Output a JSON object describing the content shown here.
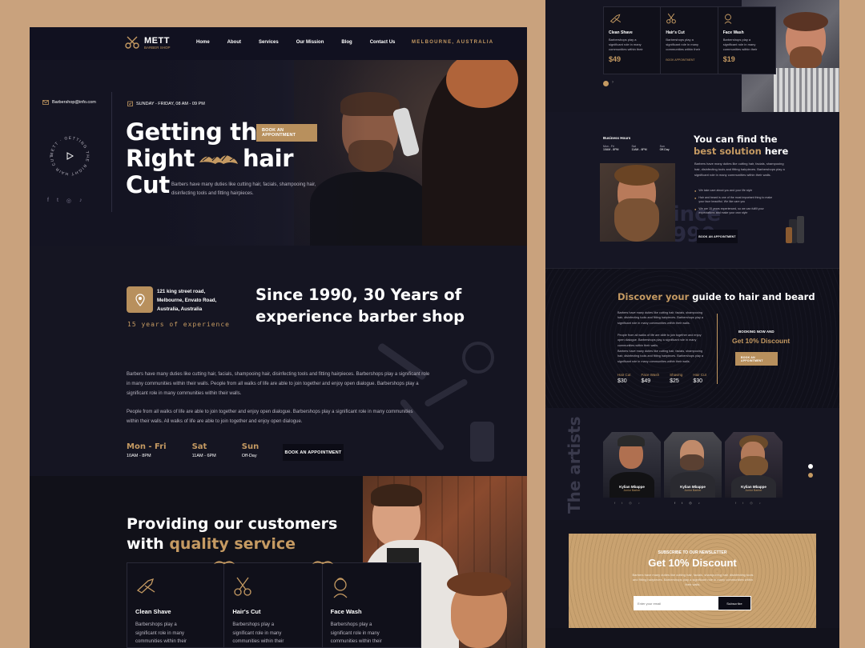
{
  "colors": {
    "background": "#c9a27d",
    "page": "#14141f",
    "gold": "#c59a62",
    "dark": "#0c0c16"
  },
  "nav": {
    "brand": "METT",
    "brand_sub": "BARBER SHOP",
    "items": [
      "Home",
      "About",
      "Services",
      "Our Mission",
      "Blog",
      "Contact Us"
    ],
    "location": "MELBOURNE, AUSTRALIA"
  },
  "hero": {
    "email": "Barbershop@info.com",
    "hours": "SUNDAY - FRIDAY, 08 AM - 09 PM",
    "badge_text": "METT · GETTING THE RIGHT HAIR CUT ·",
    "title_line1": "Getting the",
    "title_line2a": "Right",
    "title_line2b": "hair",
    "title_line3": "Cut",
    "cta": "BOOK AN APPOINTMENT",
    "desc": "Barbers have many duties like cutting hair, facials, shampooing hair, disinfecting tools and fitting hairpieces.",
    "socials": [
      "f",
      "t",
      "◎",
      "♪"
    ]
  },
  "about": {
    "address": "121 king street road, Melbourne, Envato Road, Australia, Australia",
    "experience": "15 years of experience",
    "title_line1": "Since 1990, 30 Years of",
    "title_line2": "experience barber shop",
    "para1": "Barbers have many duties like cutting hair, facials, shampooing hair, disinfecting tools and fitting hairpieces. Barbershops play a significant role in many communities within their walls. People from all walks of life are able to join together and enjoy open dialogue. Barbershops play a significant role in many communities within their walls.",
    "para2": "People from all walks of life are able to join together and enjoy open dialogue. Barbershops play a significant role in many communities within their walls. All walks of life are able to join together and enjoy open dialogue.",
    "hours": [
      {
        "day": "Mon - Fri",
        "time": "10AM - 8PM"
      },
      {
        "day": "Sat",
        "time": "11AM - 6PM"
      },
      {
        "day": "Sun",
        "time": "Off-Day"
      }
    ],
    "cta": "BOOK AN APPOINTMENT"
  },
  "quality": {
    "title_line1": "Providing our customers",
    "title_line2a": "with",
    "title_line2b": "quality service",
    "services": [
      {
        "name": "Clean Shave",
        "text": "Barbershops play a significant role in many communities within their"
      },
      {
        "name": "Hair's Cut",
        "text": "Barbershops play a significant role in many communities within their"
      },
      {
        "name": "Face Wash",
        "text": "Barbershops play a significant role in many communities within their"
      }
    ]
  },
  "right_services": {
    "items": [
      {
        "name": "Clean Shave",
        "text": "Barbershops play a significant role in many communities within their",
        "price": "$49"
      },
      {
        "name": "Hair's Cut",
        "text": "Barbershops play a significant role in many communities within their",
        "price": "BOOK APPOINTMENT"
      },
      {
        "name": "Face Wash",
        "text": "Barbershops play a significant role in many communities within their",
        "price": "$19"
      }
    ]
  },
  "solution": {
    "business_hours": "Business Hours",
    "hours": [
      {
        "day": "Mon - Fri",
        "time": "10AM - 8PM"
      },
      {
        "day": "Sat",
        "time": "11AM - 6PM"
      },
      {
        "day": "Sun",
        "time": "Off-Day"
      }
    ],
    "title_a": "You can find the",
    "title_b": "best",
    "title_c": "solution",
    "title_d": "here",
    "desc": "Barbers have many duties like cutting hair, facials, shampooing hair, disinfecting tools and fitting hairpieces. Barbershops play a significant role in many communities within their walls.",
    "checks": [
      "We take care about you and your life style",
      "Hair and beard is one of the most important thing to make your face beautiful. We like care you",
      "We are 15 years experienced, so we can fulfill your expectations and make your own style"
    ],
    "watermark_line1": "Since",
    "watermark_line2": "1990",
    "cta": "BOOK AN APPOINTMENT"
  },
  "guide": {
    "title_a": "Discover your",
    "title_b": "guide to",
    "title_c": "hair and beard",
    "paras": [
      "Barbers have many duties like cutting hair, facials, shampooing hair, disinfecting tools and fitting hairpieces. Barbershops play a significant role in many communities within their walls.",
      "People from all walks of life are able to join together and enjoy open dialogue. Barbershops play a significant role in many communities within their walls.",
      "Barbers have many duties like cutting hair, facials, shampooing hair, disinfecting tools and fitting hairpieces. Barbershops play a significant role in many communities within their walls."
    ],
    "prices": [
      {
        "name": "Hair Cut",
        "price": "$30"
      },
      {
        "name": "Face Wash",
        "price": "$49"
      },
      {
        "name": "Shaving",
        "price": "$25"
      },
      {
        "name": "Hair Cut",
        "price": "$30"
      }
    ],
    "booking_label": "BOOKING NOW AND",
    "discount": "Get 10% Discount",
    "cta": "BOOK AN APPOINTMENT"
  },
  "artists": {
    "title": "The artists",
    "people": [
      {
        "name": "Kylian Mbappe",
        "role": "Junior Barber"
      },
      {
        "name": "Kylian Mbappe",
        "role": "Junior Barber"
      },
      {
        "name": "Kylian Mbappe",
        "role": "Junior Barber"
      }
    ]
  },
  "newsletter": {
    "label": "SUBSCRIBE TO OUR NEWSLETTER",
    "title": "Get 10% Discount",
    "desc": "Barbers have many duties like cutting hair, facials, shampooing hair, disinfecting tools and fitting hairpieces. Barbershops play a significant role in many communities within their walls.",
    "placeholder": "Enter your email",
    "button": "Subscribe"
  }
}
